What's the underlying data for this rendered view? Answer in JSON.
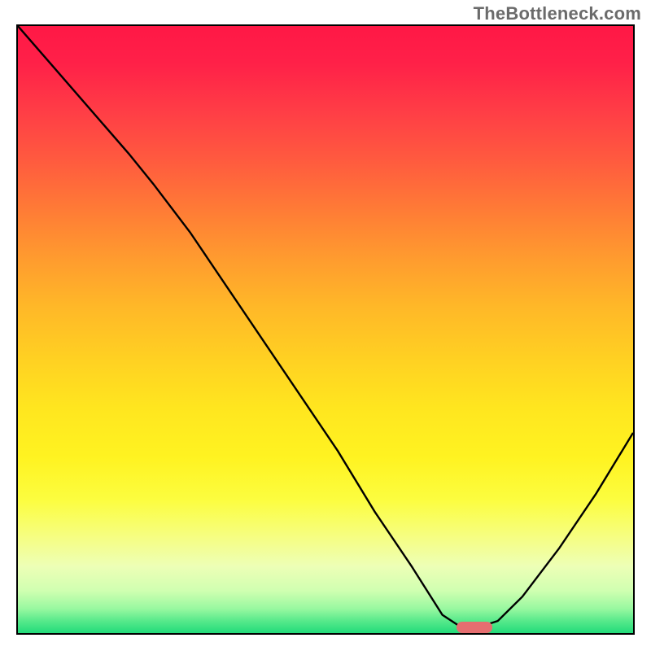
{
  "watermark": "TheBottleneck.com",
  "colors": {
    "border": "#000000",
    "curve": "#000000",
    "marker": "#e66e70",
    "watermark_text": "#6b6b6b"
  },
  "chart_data": {
    "type": "line",
    "title": "",
    "xlabel": "",
    "ylabel": "",
    "xlim": [
      0,
      100
    ],
    "ylim": [
      0,
      100
    ],
    "description": "Bottleneck / fit curve on a red-to-green vertical gradient background. Y=100 means worst (red), Y=0 means best (green). Curve descends from top-left to a flat minimum near x≈70-77, then rises again toward the right.",
    "series": [
      {
        "name": "bottleneck-curve",
        "x": [
          0,
          6,
          12,
          18,
          22,
          28,
          34,
          40,
          46,
          52,
          58,
          64,
          69,
          72,
          75,
          78,
          82,
          88,
          94,
          100
        ],
        "y": [
          100,
          93,
          86,
          79,
          74,
          66,
          57,
          48,
          39,
          30,
          20,
          11,
          3,
          1,
          1,
          2,
          6,
          14,
          23,
          33
        ]
      }
    ],
    "marker": {
      "x": 74,
      "y": 1.2,
      "label": "optimal-point"
    },
    "background_gradient_stops": [
      {
        "pos": 0,
        "color": "#ff1846"
      },
      {
        "pos": 50,
        "color": "#ffc524"
      },
      {
        "pos": 80,
        "color": "#fcfd60"
      },
      {
        "pos": 100,
        "color": "#22db7a"
      }
    ]
  }
}
